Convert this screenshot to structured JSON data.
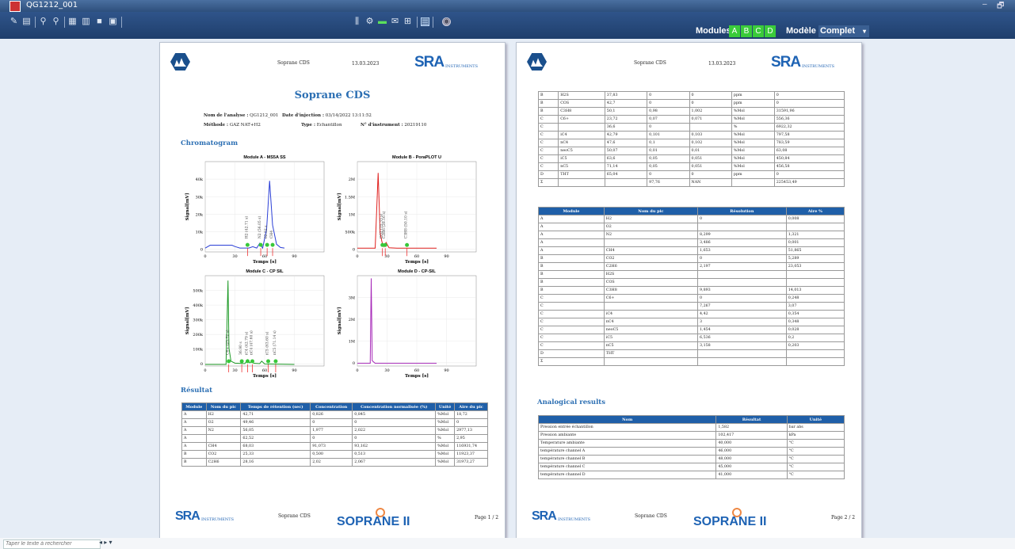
{
  "window": {
    "title": "QG1212_001",
    "controls": [
      "–",
      "🗗"
    ]
  },
  "toolbar": {
    "modules_label": "Modules :",
    "modules": [
      "A",
      "B",
      "C",
      "D"
    ],
    "modele_label": "Modèle :",
    "modele_value": "Complet"
  },
  "report": {
    "app_name": "Soprane CDS",
    "date": "13.03.2023",
    "sra_logo": "SRA",
    "sra_sub": "INSTRUMENTS",
    "title": "Soprane CDS",
    "analysis_label": "Nom de l'analyse :",
    "analysis_value": "QG1212_001",
    "injection_label": "Date d'injection :",
    "injection_value": "03/14/2022 13:11:52",
    "method_label": "Méthode :",
    "method_value": "GAZ NAT+H2",
    "type_label": "Type :",
    "type_value": "Echantillon",
    "instrument_label": "N° d'instrument :",
    "instrument_value": "20219110",
    "chromatogram_heading": "Chromatogram",
    "result_heading": "Résultat",
    "analogical_heading": "Analogical results",
    "footer_soprane": "SOPRANE II",
    "page1": "Page 1 / 2",
    "page2": "Page 2 / 2"
  },
  "chart_data": [
    {
      "type": "line",
      "title": "Module A - MS5A SS",
      "xlabel": "Temps [s]",
      "ylabel": "Signal[mV]",
      "xlim": [
        0,
        120
      ],
      "ylim": [
        -2000,
        45000
      ],
      "yticks": [
        "0",
        "10k",
        "20k",
        "30k",
        "40k"
      ],
      "xticks": [
        "0",
        "30",
        "60",
        "90"
      ],
      "color": "#2b3fd6",
      "x": [
        0,
        5,
        27,
        30,
        35,
        40,
        44,
        48,
        52,
        55,
        58,
        62,
        65,
        68,
        72,
        76,
        80
      ],
      "y": [
        0,
        1500,
        1500,
        800,
        0,
        0,
        0,
        700,
        0,
        2500,
        0,
        10000,
        35000,
        12000,
        2000,
        300,
        0
      ],
      "peaks": [
        {
          "x": 42.71,
          "label": "H2 (42.71 s)"
        },
        {
          "x": 56.05,
          "label": "N2 (56.05 s)"
        },
        {
          "x": 62.52,
          "label": "62.52 s"
        },
        {
          "x": 68.03,
          "label": "CH4"
        }
      ]
    },
    {
      "type": "line",
      "title": "Module B - PoraPLOT U",
      "xlabel": "Temps [s]",
      "ylabel": "Signal[mV]",
      "xlim": [
        0,
        120
      ],
      "ylim": [
        -100000,
        2300000
      ],
      "yticks": [
        "0",
        "500k",
        "1M",
        "1.5M",
        "2M"
      ],
      "xticks": [
        "0",
        "30",
        "60",
        "90"
      ],
      "color": "#e0201e",
      "x": [
        0,
        10,
        18,
        21,
        23,
        25,
        27,
        29,
        32,
        40,
        50,
        80
      ],
      "y": [
        0,
        0,
        0,
        2000000,
        400000,
        150000,
        40000,
        150000,
        10000,
        0,
        0,
        0
      ],
      "peaks": [
        {
          "x": 25.33,
          "label": "CO2 (25.33 s)"
        },
        {
          "x": 28.16,
          "label": "C2H6 (28.16 s)"
        },
        {
          "x": 50.1,
          "label": "C3H8 (50.10 s)"
        }
      ]
    },
    {
      "type": "line",
      "title": "Module C - CP SIL",
      "xlabel": "Temps [s]",
      "ylabel": "Signal[mV]",
      "xlim": [
        0,
        120
      ],
      "ylim": [
        -10000,
        550000
      ],
      "yticks": [
        "0",
        "100k",
        "200k",
        "300k",
        "400k",
        "500k"
      ],
      "xticks": [
        "0",
        "30",
        "60",
        "90"
      ],
      "color": "#1d9a26",
      "x": [
        0,
        15,
        21,
        23,
        24,
        26,
        30,
        40,
        43,
        45,
        47,
        49,
        55,
        57,
        60,
        90
      ],
      "y": [
        0,
        0,
        0,
        520000,
        100000,
        20000,
        8000,
        5000,
        30000,
        9000,
        20000,
        7000,
        5000,
        20000,
        3000,
        0
      ],
      "peaks": [
        {
          "x": 23.72,
          "label": "C6+ (23.72 s)"
        },
        {
          "x": 36.9,
          "label": "36.90 s"
        },
        {
          "x": 42.79,
          "label": "iC4 (42.79 s)"
        },
        {
          "x": 47.6,
          "label": "nC4 (47.60 s)"
        },
        {
          "x": 63.6,
          "label": "iC5 (63.60 s)"
        },
        {
          "x": 71.14,
          "label": "nC5 (71.14 s)"
        }
      ]
    },
    {
      "type": "line",
      "title": "Module D - CP-SIL",
      "xlabel": "Temps [s]",
      "ylabel": "Signal[mV]",
      "xlim": [
        0,
        120
      ],
      "ylim": [
        -100000,
        3300000
      ],
      "yticks": [
        "0",
        "1M",
        "2M",
        "3M"
      ],
      "xticks": [
        "0",
        "30",
        "60",
        "90"
      ],
      "color": "#a628b8",
      "x": [
        0,
        10,
        13,
        14,
        15,
        18,
        30,
        80
      ],
      "y": [
        0,
        0,
        0,
        3200000,
        100000,
        0,
        0,
        0
      ],
      "peaks": []
    }
  ],
  "result_table": {
    "headers": [
      "Module",
      "Nom du pic",
      "Temps de rétention (sec)",
      "Concentration",
      "Concentration normalisée (%)",
      "Unité",
      "Aire du pic"
    ],
    "rows": [
      [
        "A",
        "H2",
        "42,71",
        "0,826",
        "0,845",
        "%Mol",
        "18,72"
      ],
      [
        "A",
        "O2",
        "49,46",
        "0",
        "0",
        "%Mol",
        "0"
      ],
      [
        "A",
        "N2",
        "56,05",
        "1,977",
        "2,022",
        "%Mol",
        "2977,13"
      ],
      [
        "A",
        "",
        "62,52",
        "0",
        "0",
        "%",
        "2,95"
      ],
      [
        "A",
        "CH4",
        "68,03",
        "91,073",
        "93,162",
        "%Mol",
        "116931,74"
      ],
      [
        "B",
        "CO2",
        "25,33",
        "0,500",
        "0,513",
        "%Mol",
        "11923,37"
      ],
      [
        "B",
        "C2H6",
        "28,16",
        "2,02",
        "2,067",
        "%Mol",
        "31973,27"
      ]
    ]
  },
  "continued_table": {
    "rows": [
      [
        "B",
        "H2S",
        "37,83",
        "0",
        "0",
        "ppm",
        "0"
      ],
      [
        "B",
        "COS",
        "42,7",
        "0",
        "0",
        "ppm",
        "0"
      ],
      [
        "B",
        "C3H8",
        "50,1",
        "0,98",
        "1,002",
        "%Mol",
        "31591,96"
      ],
      [
        "C",
        "C6+",
        "23,72",
        "0,07",
        "0,071",
        "%Mol",
        "556,36"
      ],
      [
        "C",
        "",
        "36,6",
        "0",
        "",
        "%",
        "6922,32"
      ],
      [
        "C",
        "iC4",
        "42,79",
        "0,101",
        "0,103",
        "%Mol",
        "797,58"
      ],
      [
        "C",
        "nC4",
        "47,6",
        "0,1",
        "0,102",
        "%Mol",
        "783,59"
      ],
      [
        "C",
        "neoC5",
        "50,07",
        "0,01",
        "0,01",
        "%Mol",
        "63,08"
      ],
      [
        "C",
        "iC5",
        "63,6",
        "0,05",
        "0,051",
        "%Mol",
        "450,84"
      ],
      [
        "C",
        "nC5",
        "71,14",
        "0,05",
        "0,051",
        "%Mol",
        "456,58"
      ],
      [
        "D",
        "THT",
        "65,04",
        "0",
        "0",
        "ppm",
        "0"
      ],
      [
        "Σ",
        "",
        "",
        "97,76",
        "NAN",
        "",
        "225453,49"
      ]
    ]
  },
  "resolution_table": {
    "headers": [
      "Module",
      "Nom du pic",
      "Résolution",
      "Aire %"
    ],
    "rows": [
      [
        "A",
        "H2",
        "0",
        "0,008"
      ],
      [
        "A",
        "O2",
        "",
        ""
      ],
      [
        "A",
        "N2",
        "8,299",
        "1,321"
      ],
      [
        "A",
        "",
        "3,486",
        "0,001"
      ],
      [
        "A",
        "CH4",
        "1,653",
        "51,865"
      ],
      [
        "B",
        "CO2",
        "0",
        "5,289"
      ],
      [
        "B",
        "C2H6",
        "2,197",
        "23,053"
      ],
      [
        "B",
        "H2S",
        "",
        ""
      ],
      [
        "B",
        "COS",
        "",
        ""
      ],
      [
        "B",
        "C3H8",
        "9,893",
        "14,013"
      ],
      [
        "C",
        "C6+",
        "0",
        "0,248"
      ],
      [
        "C",
        "",
        "7,267",
        "3,07"
      ],
      [
        "C",
        "iC4",
        "4,42",
        "0,354"
      ],
      [
        "C",
        "nC4",
        "3",
        "0,348"
      ],
      [
        "C",
        "neoC5",
        "1,454",
        "0,028"
      ],
      [
        "C",
        "iC5",
        "6,536",
        "0,2"
      ],
      [
        "C",
        "nC5",
        "3,158",
        "0,203"
      ],
      [
        "D",
        "THT",
        "",
        ""
      ],
      [
        "Σ",
        "",
        "",
        ""
      ]
    ]
  },
  "analog_table": {
    "headers": [
      "Nom",
      "Résultat",
      "Unité"
    ],
    "rows": [
      [
        "Pression entrée échantillon",
        "1,582",
        "bar abs"
      ],
      [
        "Pression ambiante",
        "102,417",
        "kPa"
      ],
      [
        "Temperature ambiante",
        "40,000",
        "°C"
      ],
      [
        "température channel A",
        "46,000",
        "°C"
      ],
      [
        "température channel B",
        "48,000",
        "°C"
      ],
      [
        "température channel C",
        "45,000",
        "°C"
      ],
      [
        "température channel D",
        "41,000",
        "°C"
      ]
    ]
  },
  "search": {
    "placeholder": "Taper le texte à rechercher"
  }
}
